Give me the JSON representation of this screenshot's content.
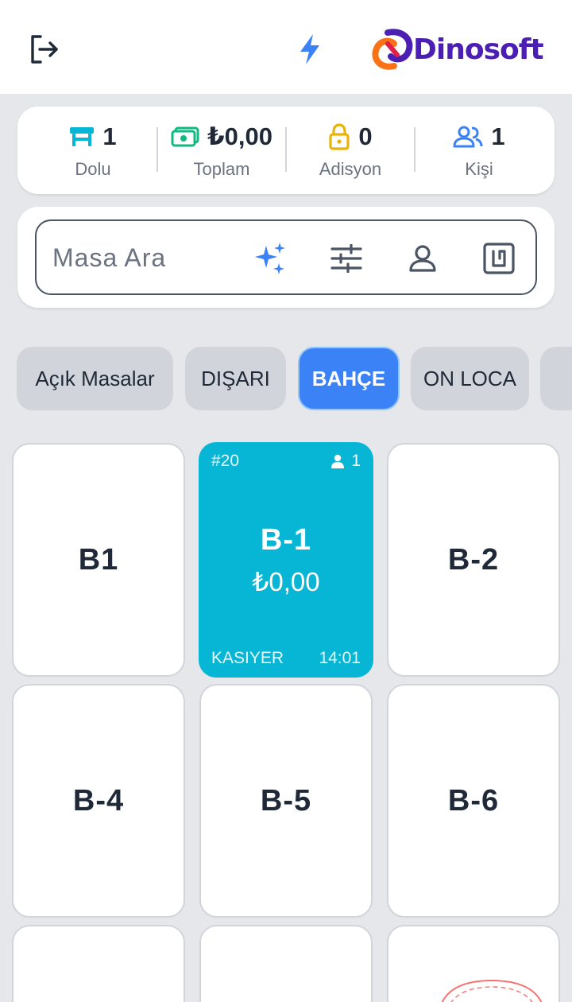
{
  "header": {
    "logout_icon": "logout-icon",
    "quick_icon": "lightning-bolt-icon",
    "brand": "Dinosoft",
    "brand_icon": "dinosoft-logo-icon"
  },
  "stats": [
    {
      "icon": "table-icon",
      "value": "1",
      "label": "Dolu",
      "color": "#06b6d4"
    },
    {
      "icon": "banknote-icon",
      "value": "₺0,00",
      "label": "Toplam",
      "color": "#10b981"
    },
    {
      "icon": "lock-icon",
      "value": "0",
      "label": "Adisyon",
      "color": "#eab308"
    },
    {
      "icon": "users-icon",
      "value": "1",
      "label": "Kişi",
      "color": "#3b82f6"
    }
  ],
  "search": {
    "placeholder": "Masa Ara",
    "icons": [
      "sparkles-icon",
      "sliders-icon",
      "person-icon",
      "nfc-card-icon"
    ]
  },
  "tabs": [
    {
      "label": "Açık Masalar",
      "active": false
    },
    {
      "label": "DIŞARI",
      "active": false
    },
    {
      "label": "BAHÇE",
      "active": true
    },
    {
      "label": "ON LOCA",
      "active": false
    },
    {
      "label": "",
      "active": false
    }
  ],
  "tables": [
    {
      "name": "B1"
    },
    {
      "name": "B-1",
      "occupied": true,
      "number": "#20",
      "guests": "1",
      "amount": "₺0,00",
      "user": "KASIYER",
      "time": "14:01"
    },
    {
      "name": "B-2"
    },
    {
      "name": "B-4"
    },
    {
      "name": "B-5"
    },
    {
      "name": "B-6"
    },
    {
      "name": ""
    },
    {
      "name": ""
    },
    {
      "name": ""
    }
  ],
  "colors": {
    "accent": "#3b82f6",
    "occupied": "#06b6d4",
    "brand": "#4b1fb3"
  }
}
